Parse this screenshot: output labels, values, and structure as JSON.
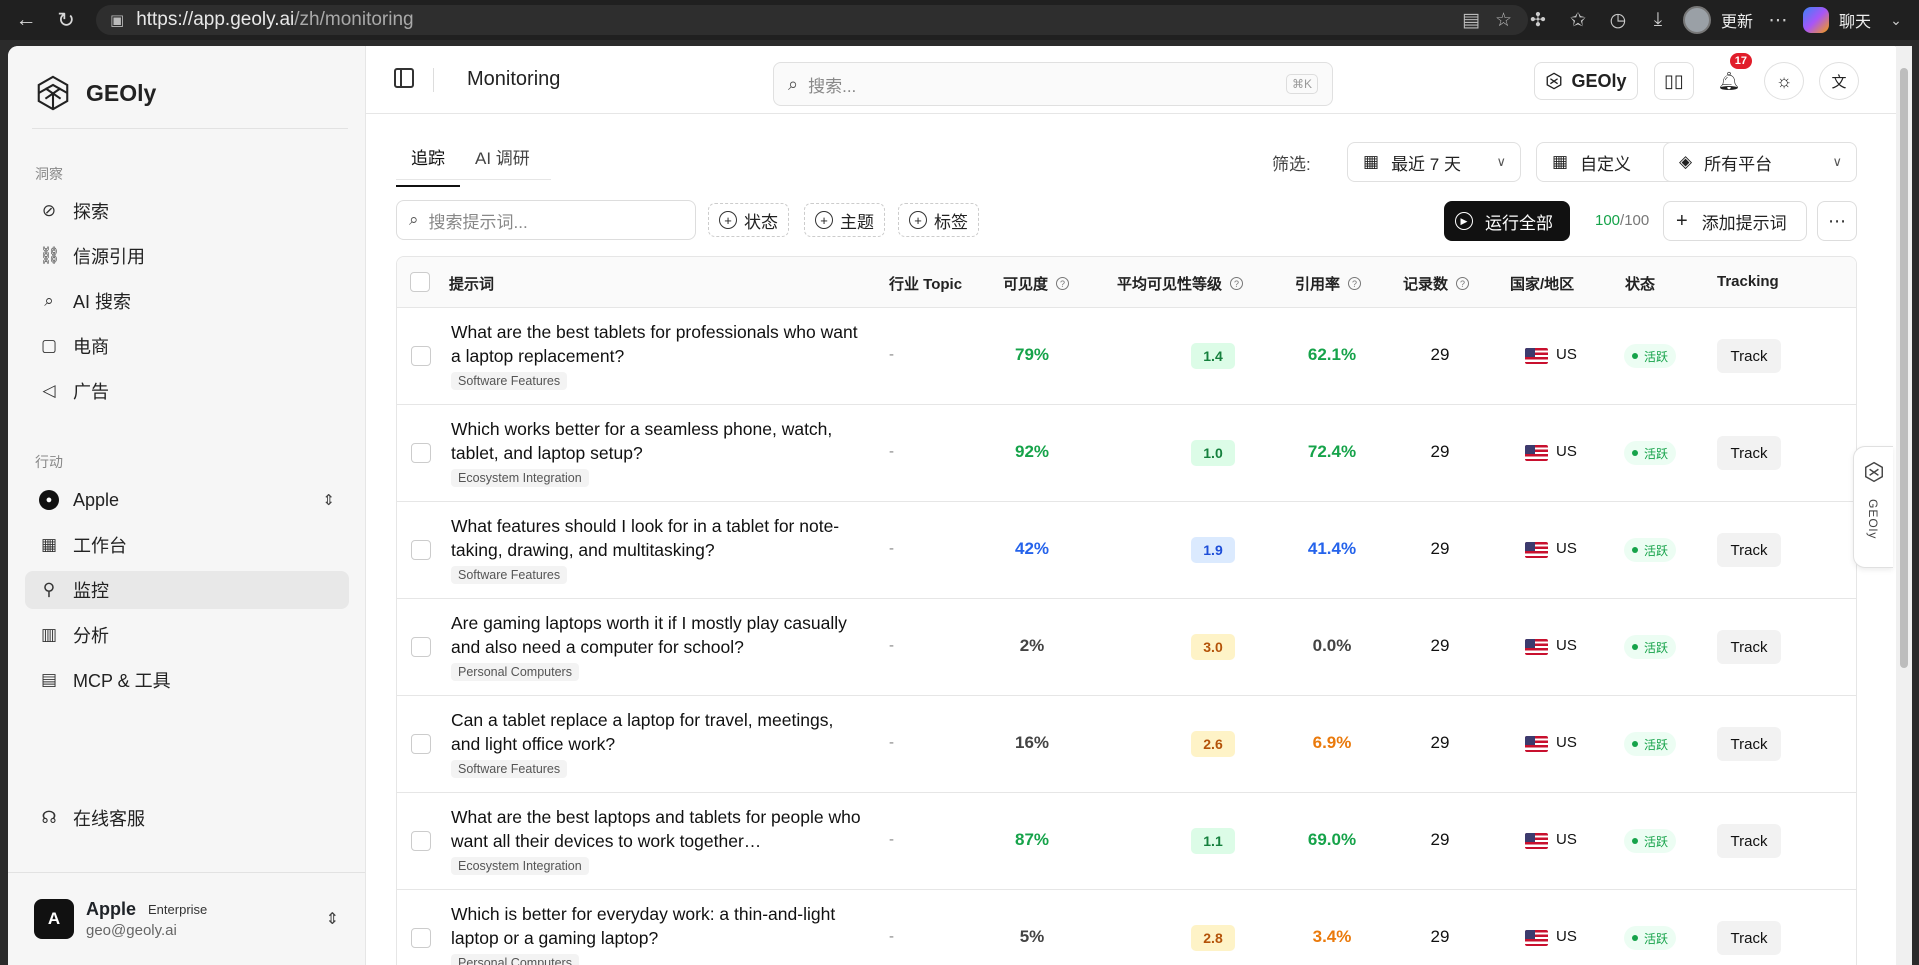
{
  "browser": {
    "url_host": "https://app.geoly.ai",
    "url_path": "/zh/monitoring",
    "update_label": "更新",
    "chat_label": "聊天"
  },
  "sidebar": {
    "brand": "GEOly",
    "section_insight": "洞察",
    "insight_items": [
      "探索",
      "信源引用",
      "AI 搜索",
      "电商",
      "广告"
    ],
    "section_action": "行动",
    "brand_switch": "Apple",
    "action_items": [
      "工作台",
      "监控",
      "分析",
      "MCP & 工具"
    ],
    "support": "在线客服",
    "user": {
      "initial": "A",
      "name": "Apple",
      "plan": "Enterprise",
      "email": "geo@geoly.ai"
    }
  },
  "topbar": {
    "title": "Monitoring",
    "search_placeholder": "搜索...",
    "shortcut": "⌘K",
    "brand_button": "GEOly",
    "notifications": "17"
  },
  "tabs": [
    "追踪",
    "AI 调研"
  ],
  "filters": {
    "label": "筛选:",
    "range": "最近 7 天",
    "custom": "自定义",
    "platform": "所有平台"
  },
  "toolbar": {
    "search_placeholder": "搜索提示词...",
    "chip_status": "状态",
    "chip_topic": "主题",
    "chip_tags": "标签",
    "run_all": "运行全部",
    "quota_used": "100",
    "quota_total": "/100",
    "add_prompt": "添加提示词"
  },
  "table": {
    "headers": {
      "prompt": "提示词",
      "industry": "行业 Topic",
      "visibility": "可见度",
      "avg_rank": "平均可见性等级",
      "citation": "引用率",
      "records": "记录数",
      "country": "国家/地区",
      "status": "状态",
      "tracking": "Tracking"
    },
    "rows": [
      {
        "prompt": "What are the best tablets for professionals who want a laptop replacement?",
        "tag": "Software Features",
        "industry": "-",
        "visibility": "79%",
        "vis_color": "green",
        "rank": "1.4",
        "rank_color": "green",
        "citation": "62.1%",
        "cite_color": "green",
        "records": "29",
        "country": "US",
        "status": "活跃",
        "track": "Track"
      },
      {
        "prompt": "Which works better for a seamless phone, watch, tablet, and laptop setup?",
        "tag": "Ecosystem Integration",
        "industry": "-",
        "visibility": "92%",
        "vis_color": "green",
        "rank": "1.0",
        "rank_color": "green",
        "citation": "72.4%",
        "cite_color": "green",
        "records": "29",
        "country": "US",
        "status": "活跃",
        "track": "Track"
      },
      {
        "prompt": "What features should I look for in a tablet for note-taking, drawing, and multitasking?",
        "tag": "Software Features",
        "industry": "-",
        "visibility": "42%",
        "vis_color": "blue",
        "rank": "1.9",
        "rank_color": "blue",
        "citation": "41.4%",
        "cite_color": "blue",
        "records": "29",
        "country": "US",
        "status": "活跃",
        "track": "Track"
      },
      {
        "prompt": "Are gaming laptops worth it if I mostly play casually and also need a computer for school?",
        "tag": "Personal Computers",
        "industry": "-",
        "visibility": "2%",
        "vis_color": "gray",
        "rank": "3.0",
        "rank_color": "yellow",
        "citation": "0.0%",
        "cite_color": "gray",
        "records": "29",
        "country": "US",
        "status": "活跃",
        "track": "Track"
      },
      {
        "prompt": "Can a tablet replace a laptop for travel, meetings, and light office work?",
        "tag": "Software Features",
        "industry": "-",
        "visibility": "16%",
        "vis_color": "gray",
        "rank": "2.6",
        "rank_color": "yellow",
        "citation": "6.9%",
        "cite_color": "orange",
        "records": "29",
        "country": "US",
        "status": "活跃",
        "track": "Track"
      },
      {
        "prompt": "What are the best laptops and tablets for people who want all their devices to work together…",
        "tag": "Ecosystem Integration",
        "industry": "-",
        "visibility": "87%",
        "vis_color": "green",
        "rank": "1.1",
        "rank_color": "green",
        "citation": "69.0%",
        "cite_color": "green",
        "records": "29",
        "country": "US",
        "status": "活跃",
        "track": "Track"
      },
      {
        "prompt": "Which is better for everyday work: a thin-and-light laptop or a gaming laptop?",
        "tag": "Personal Computers",
        "industry": "-",
        "visibility": "5%",
        "vis_color": "gray",
        "rank": "2.8",
        "rank_color": "yellow",
        "citation": "3.4%",
        "cite_color": "orange",
        "records": "29",
        "country": "US",
        "status": "活跃",
        "track": "Track"
      }
    ]
  },
  "float_tab": "GEOly"
}
